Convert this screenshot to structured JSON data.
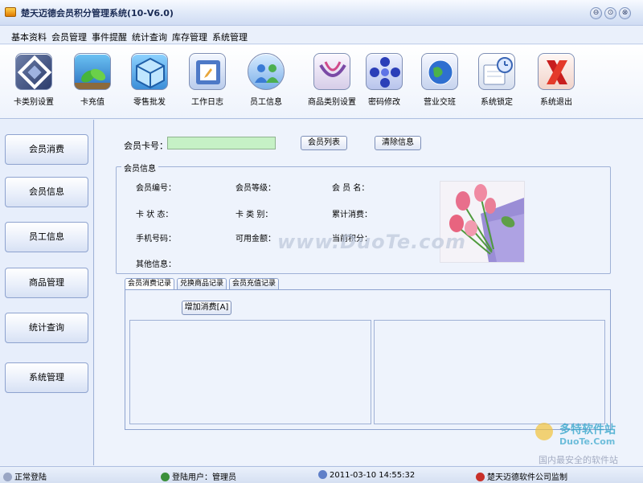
{
  "window": {
    "title": "楚天迈德会员积分管理系统(10-V6.0)",
    "buttons": [
      "⊖",
      "⊙",
      "⊗"
    ]
  },
  "menu": [
    "基本资料",
    "会员管理",
    "事件提醒",
    "统计查询",
    "库存管理",
    "系统管理"
  ],
  "toolbar": [
    {
      "label": "卡类别设置",
      "icon": "card-type-icon"
    },
    {
      "label": "卡充值",
      "icon": "leaf-icon"
    },
    {
      "label": "零售批发",
      "icon": "cube-icon"
    },
    {
      "label": "工作日志",
      "icon": "log-icon"
    },
    {
      "label": "员工信息",
      "icon": "staff-icon"
    },
    {
      "label": "商品类别设置",
      "icon": "category-icon"
    },
    {
      "label": "密码修改",
      "icon": "password-icon"
    },
    {
      "label": "营业交班",
      "icon": "globe-icon"
    },
    {
      "label": "系统锁定",
      "icon": "lock-clock-icon"
    },
    {
      "label": "系统退出",
      "icon": "exit-icon"
    }
  ],
  "sidebar": [
    "会员消费",
    "会员信息",
    "员工信息",
    "商品管理",
    "统计查询",
    "系统管理"
  ],
  "card": {
    "label": "会员卡号：",
    "value": "",
    "list_button": "会员列表",
    "clear_button": "清除信息"
  },
  "member_info": {
    "legend": "会员信息",
    "fields": [
      "会员编号：",
      "会员等级：",
      "会 员 名：",
      "卡 状 态：",
      "卡 类 别：",
      "累计消费：",
      "手机号码：",
      "可用金额：",
      "当前积分：",
      "其他信息："
    ]
  },
  "tabs": [
    "会员消费记录",
    "兑换商品记录",
    "会员充值记录"
  ],
  "add_button": "增加消费[A]",
  "status": {
    "state": "正常登陆",
    "user": "登陆用户：管理员",
    "datetime": "2011-03-10  14:55:32",
    "company": "楚天迈德软件公司监制"
  },
  "watermark": {
    "main": "www.DuoTe.com",
    "logo": "多特软件站",
    "logo_url": "DuoTe.Com",
    "slogan": "国内最安全的软件站"
  }
}
